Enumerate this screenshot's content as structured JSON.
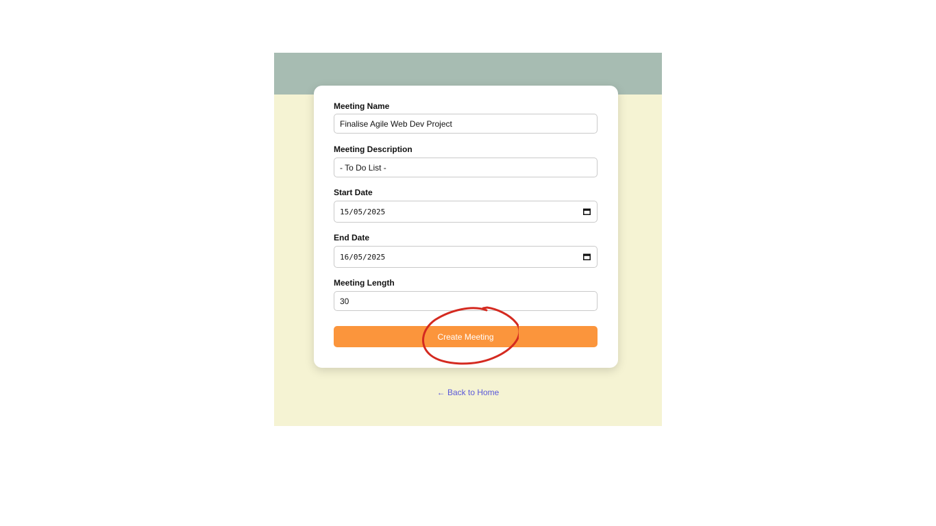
{
  "form": {
    "meeting_name": {
      "label": "Meeting Name",
      "value": "Finalise Agile Web Dev Project"
    },
    "meeting_description": {
      "label": "Meeting Description",
      "value": "- To Do List -"
    },
    "start_date": {
      "label": "Start Date",
      "value": "15/05/2025"
    },
    "end_date": {
      "label": "End Date",
      "value": "16/05/2025"
    },
    "meeting_length": {
      "label": "Meeting Length",
      "value": "30"
    },
    "submit_label": "Create Meeting"
  },
  "footer": {
    "back_link": "← Back to Home"
  },
  "colors": {
    "banner": "#a7bcb2",
    "page_background": "#f5f3d3",
    "button": "#fb953c",
    "link": "#5a58d9",
    "annotation": "#d42a20"
  },
  "icons": {
    "calendar": "calendar-icon",
    "annotation": "annotation-circle"
  }
}
